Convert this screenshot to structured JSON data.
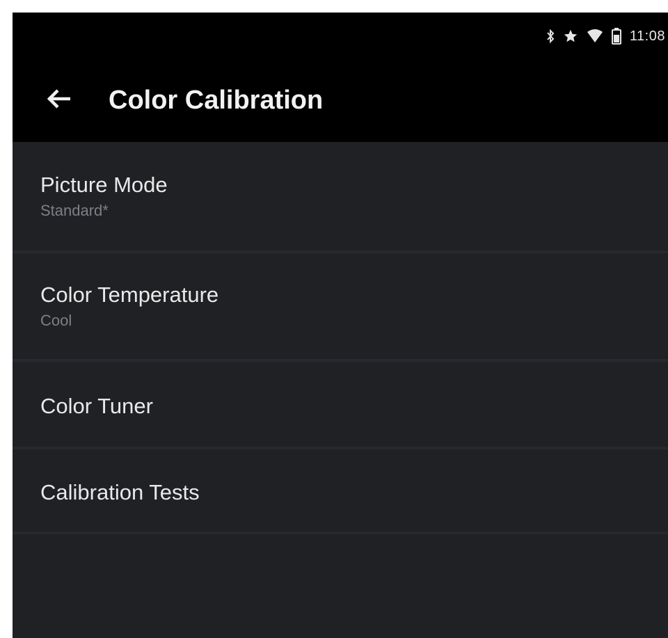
{
  "status_bar": {
    "icons": [
      "bluetooth-icon",
      "star-icon",
      "wifi-icon",
      "battery-icon"
    ],
    "time": "11:08"
  },
  "app_bar": {
    "back_icon": "back-arrow-icon",
    "title": "Color Calibration"
  },
  "menu": {
    "items": [
      {
        "label": "Picture Mode",
        "value": "Standard*"
      },
      {
        "label": "Color Temperature",
        "value": "Cool"
      },
      {
        "label": "Color Tuner"
      },
      {
        "label": "Calibration Tests"
      }
    ]
  },
  "colors": {
    "bar_background": "#000000",
    "list_background": "#1f2124",
    "divider": "#262a2e",
    "primary_text": "#e9e9e9",
    "secondary_text": "#7c8085"
  }
}
